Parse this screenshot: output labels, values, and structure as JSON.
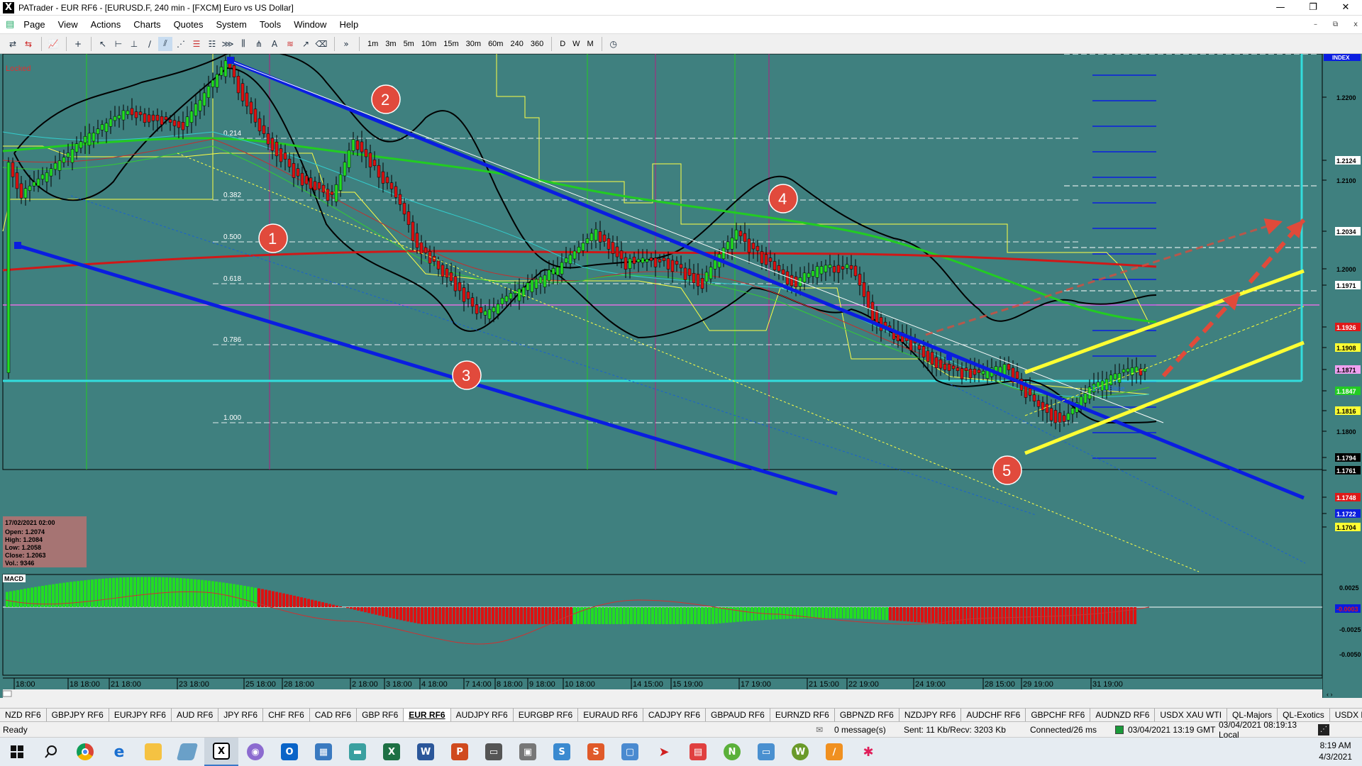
{
  "window": {
    "title": "PATrader - EUR RF6 - [EURUSD.F, 240 min - [FXCM] Euro vs US Dollar]",
    "app_icon": "X",
    "controls": [
      "—",
      "❐",
      "✕"
    ]
  },
  "menu": {
    "items": [
      "Page",
      "View",
      "Actions",
      "Charts",
      "Quotes",
      "System",
      "Tools",
      "Window",
      "Help"
    ],
    "mdi_controls": [
      "–",
      "⧉",
      "x"
    ]
  },
  "toolbar": {
    "timeframes": [
      "1m",
      "3m",
      "5m",
      "10m",
      "15m",
      "30m",
      "60m",
      "240",
      "360"
    ],
    "periods": [
      "D",
      "W",
      "M"
    ],
    "overflow": "»"
  },
  "chart": {
    "locked_label": "Locked",
    "index_label": "INDEX",
    "macd_label": "MACD",
    "price_axis": [
      {
        "label": "1.2200",
        "kind": "tick"
      },
      {
        "label": "1.2124",
        "kind": "white"
      },
      {
        "label": "1.2100",
        "kind": "tick"
      },
      {
        "label": "1.2034",
        "kind": "white"
      },
      {
        "label": "1.2000",
        "kind": "tick"
      },
      {
        "label": "1.1971",
        "kind": "white"
      },
      {
        "label": "1.1926",
        "kind": "red"
      },
      {
        "label": "1.1908",
        "kind": "yellow"
      },
      {
        "label": "1.1871",
        "kind": "magenta"
      },
      {
        "label": "1.1847",
        "kind": "green"
      },
      {
        "label": "1.1816",
        "kind": "yellow"
      },
      {
        "label": "1.1800",
        "kind": "tick"
      },
      {
        "label": "1.1794",
        "kind": "black"
      },
      {
        "label": "1.1761",
        "kind": "black"
      },
      {
        "label": "1.1748",
        "kind": "red"
      },
      {
        "label": "1.1722",
        "kind": "blue"
      },
      {
        "label": "1.1704",
        "kind": "yellow"
      }
    ],
    "macd_axis": [
      "0.0025",
      "0.0003",
      "-0.0025",
      "-0.0050"
    ],
    "macd_current": "-0.0003",
    "fib_levels": [
      "0.214",
      "0.382",
      "0.500",
      "0.618",
      "0.786",
      "1.000"
    ],
    "markers": [
      "1",
      "2",
      "3",
      "4",
      "5"
    ],
    "time_axis": [
      "18:00",
      "18 18:00",
      "21 18:00",
      "23 18:00",
      "25 18:00",
      "28 18:00",
      "2 18:00",
      "3 18:00",
      "4 18:00",
      "7 14:00",
      "8 18:00",
      "9 18:00",
      "10 18:00",
      "14 15:00",
      "15 19:00",
      "17 19:00",
      "21 15:00",
      "22 19:00",
      "24 19:00",
      "28 15:00",
      "29 19:00",
      "31 19:00"
    ],
    "ohlc_box": {
      "date": "17/02/2021 02:00",
      "open": "Open: 1.2074",
      "high": "High: 1.2084",
      "low": "Low: 1.2058",
      "close": "Close: 1.2063",
      "vol": "Vol.: 9346"
    },
    "pattern_label": "Gn 1 Base",
    "colors": {
      "background": "#3f807f",
      "channel": "#0a1de0",
      "bull": "#22dd22",
      "bear": "#dd1111",
      "ma_green": "#22cc22",
      "ma_red": "#d01818",
      "yellow": "#ffff33",
      "cyan": "#33dddd",
      "arrow": "#e04a3a"
    }
  },
  "tabs": {
    "items": [
      "NZD RF6",
      "GBPJPY RF6",
      "EURJPY RF6",
      "AUD RF6",
      "JPY RF6",
      "CHF RF6",
      "CAD RF6",
      "GBP RF6",
      "EUR RF6",
      "AUDJPY RF6",
      "EURGBP RF6",
      "EURAUD RF6",
      "CADJPY RF6",
      "GBPAUD RF6",
      "EURNZD RF6",
      "GBPNZD RF6",
      "NZDJPY RF6",
      "AUDCHF RF6",
      "GBPCHF RF6",
      "AUDNZD RF6",
      "USDX XAU WTI",
      "QL-Majors",
      "QL-Exotics",
      "USDX RF6",
      "Bitcoin"
    ],
    "active": "EUR RF6"
  },
  "status": {
    "ready": "Ready",
    "messages": "0 message(s)",
    "traffic": "Sent: 11 Kb/Recv: 3203 Kb",
    "connection": "Connected/26 ms",
    "server_time": "03/04/2021 13:19 GMT",
    "local_time": "03/04/2021 08:19:13 Local"
  },
  "taskbar": {
    "time": "8:19 AM",
    "date": "4/3/2021"
  }
}
